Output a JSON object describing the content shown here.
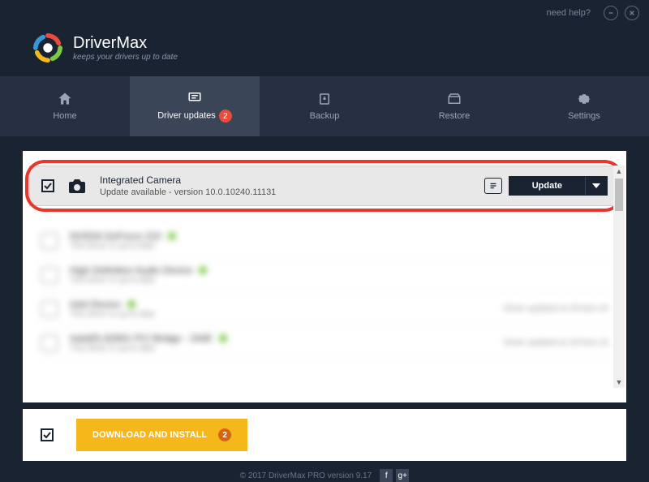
{
  "titlebar": {
    "help": "need help?"
  },
  "brand": {
    "name": "DriverMax",
    "tagline": "keeps your drivers up to date"
  },
  "nav": {
    "home": "Home",
    "updates": "Driver updates",
    "updates_badge": "2",
    "backup": "Backup",
    "restore": "Restore",
    "settings": "Settings"
  },
  "driver": {
    "name": "Integrated Camera",
    "status": "Update available - version 10.0.10240.11131",
    "update_btn": "Update"
  },
  "blurred": [
    {
      "title": "NVIDIA GeForce 210",
      "sub": "This driver is up-to-date",
      "right": ""
    },
    {
      "title": "High Definition Audio Device",
      "sub": "This driver is up-to-date",
      "right": ""
    },
    {
      "title": "Intel Device",
      "sub": "This driver is up-to-date",
      "right": "Driver updated on 03-Nov-16"
    },
    {
      "title": "Intel(R) 82801 PCI Bridge - 244E",
      "sub": "This driver is up-to-date",
      "right": "Driver updated on 03-Nov-16"
    }
  ],
  "bottom": {
    "download": "DOWNLOAD AND INSTALL",
    "badge": "2"
  },
  "footer": {
    "copyright": "© 2017 DriverMax PRO version 9.17"
  }
}
